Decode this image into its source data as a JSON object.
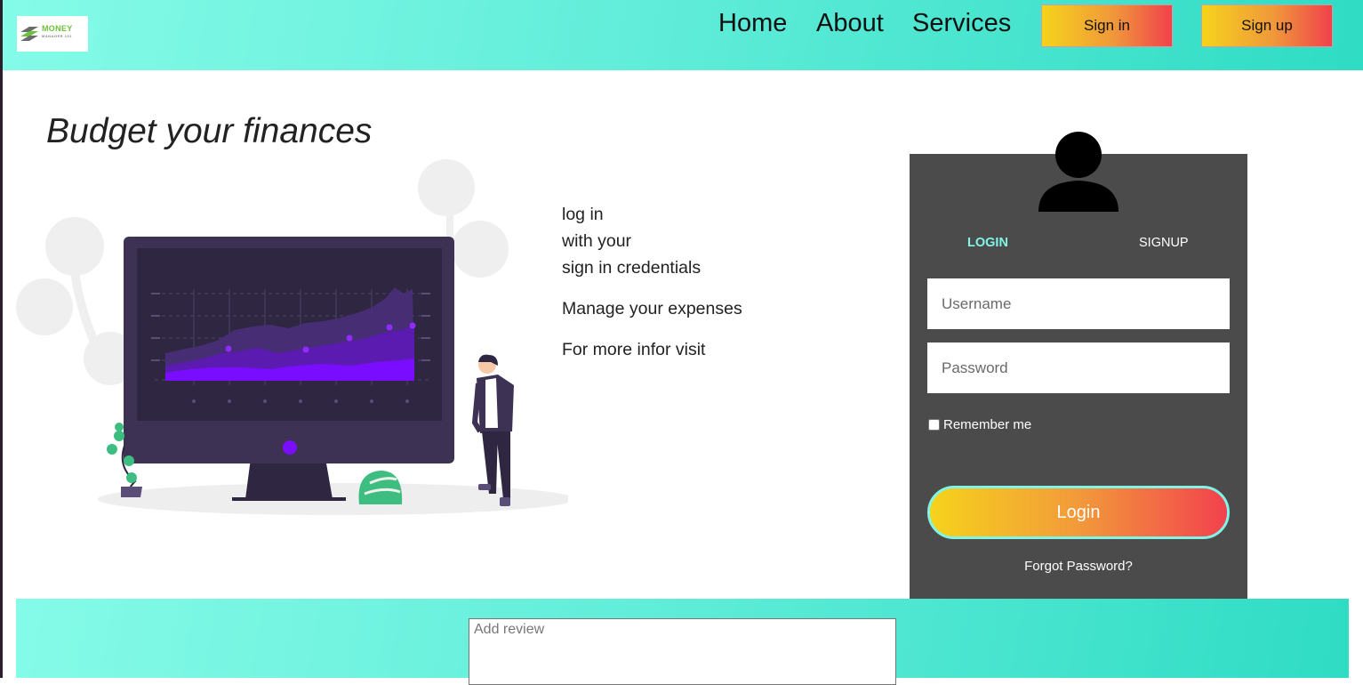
{
  "header": {
    "logo": {
      "text": "MONEY",
      "subtext": "MANAGER 101"
    },
    "nav": [
      "Home",
      "About",
      "Services"
    ],
    "signin_label": "Sign in",
    "signup_label": "Sign up"
  },
  "hero": {
    "title": "Budget your finances"
  },
  "info": {
    "line1": "log in",
    "line2": "with your",
    "line3": "sign in credentials",
    "manage": "Manage your expenses",
    "more": "For more infor visit"
  },
  "login": {
    "tab_login": "LOGIN",
    "tab_signup": "SIGNUP",
    "username_placeholder": "Username",
    "password_placeholder": "Password",
    "remember_label": "Remember me",
    "remember_checked": false,
    "login_button": "Login",
    "forgot": "Forgot Password?"
  },
  "review": {
    "placeholder": "Add review"
  },
  "colors": {
    "teal_gradient_start": "#85fbe8",
    "teal_gradient_end": "#2fdcc4",
    "panel": "#4b4b4b",
    "accent_teal": "#7ef5e6",
    "button_gradient": [
      "#f6d31c",
      "#f0983a",
      "#f1414c"
    ],
    "chart_purple": "#7a0dff"
  },
  "icons": {
    "logo": "money-manager-logo",
    "avatar": "user-silhouette-icon",
    "illustration": "person-viewing-monitor-chart-illustration"
  }
}
